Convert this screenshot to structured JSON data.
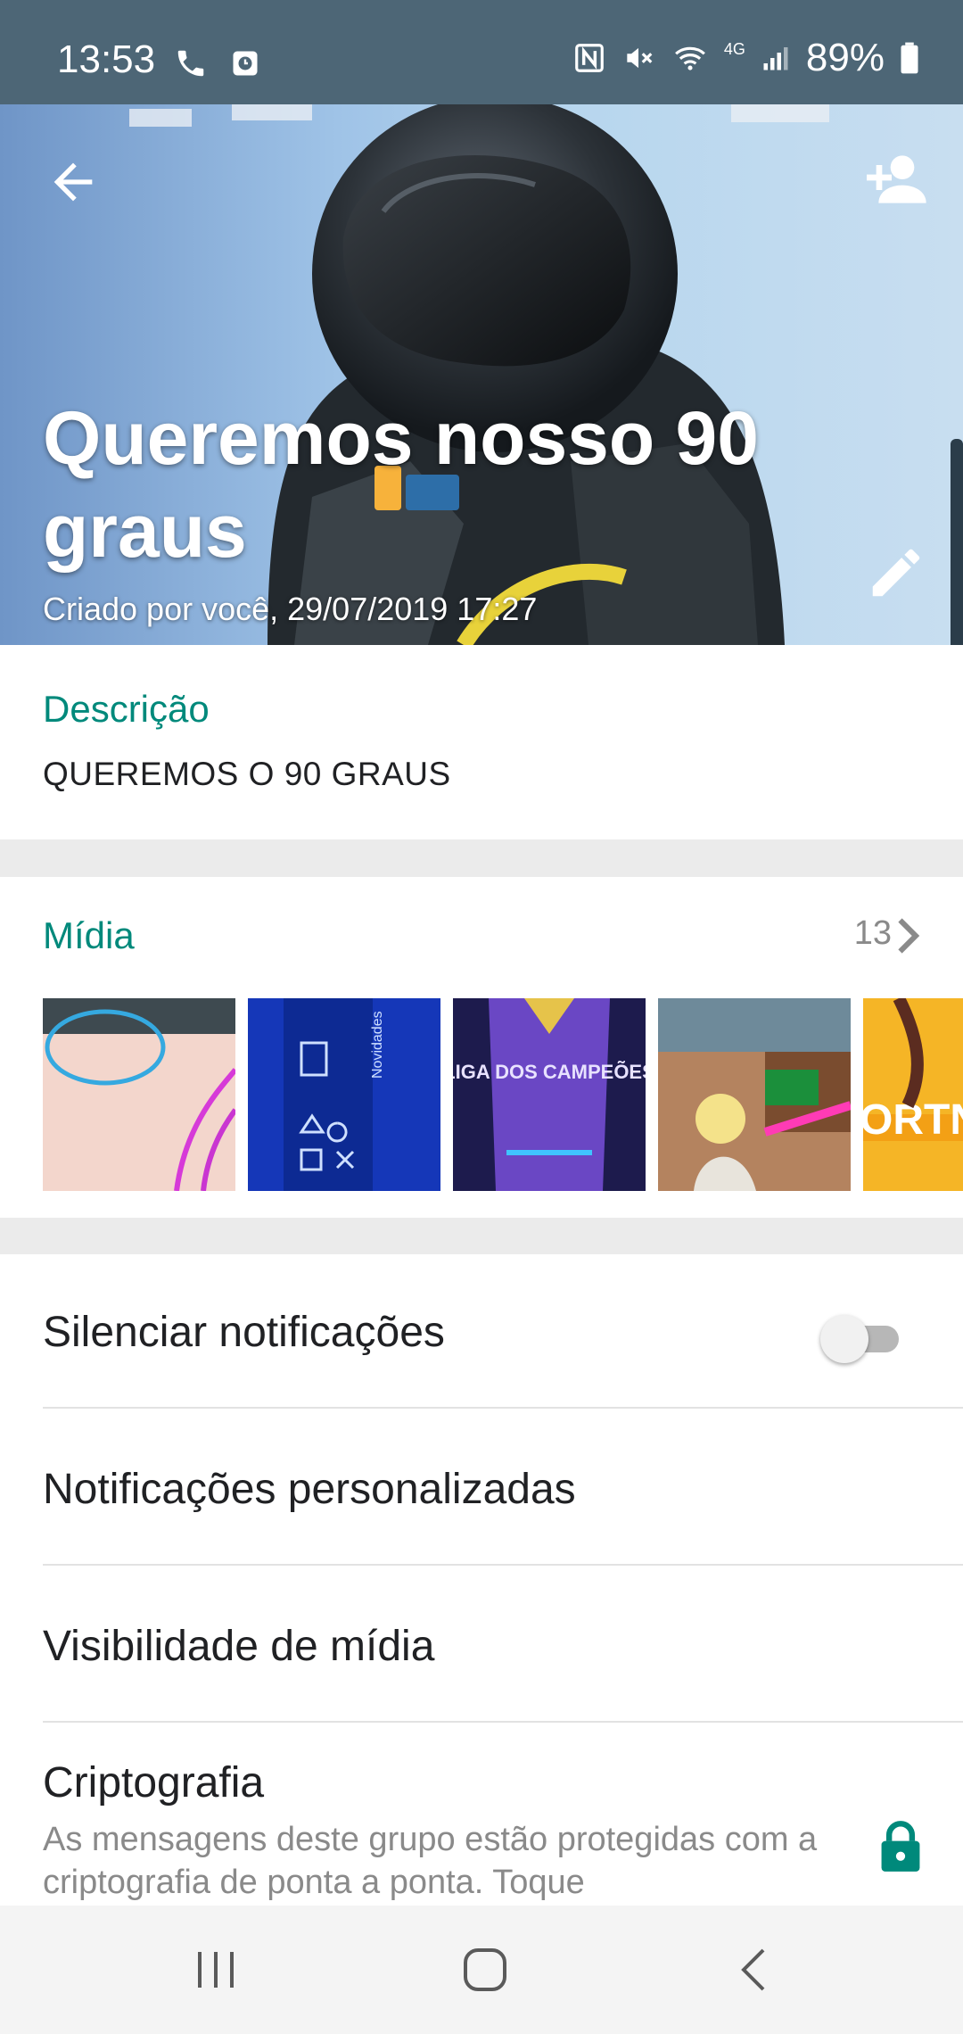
{
  "status_bar": {
    "time": "13:53",
    "network": "4G",
    "battery": "89%"
  },
  "header": {
    "title": "Queremos nosso 90 graus",
    "subtitle": "Criado por você, 29/07/2019 17:27"
  },
  "description": {
    "label": "Descrição",
    "text": "QUEREMOS O 90 GRAUS"
  },
  "media": {
    "label": "Mídia",
    "count": "13",
    "thumbnails": [
      {
        "id": "thumb-1",
        "text": ""
      },
      {
        "id": "thumb-2",
        "text": "Novidades"
      },
      {
        "id": "thumb-3",
        "text": "LIGA DOS CAMPEÕES"
      },
      {
        "id": "thumb-4",
        "text": ""
      },
      {
        "id": "thumb-5",
        "text": "ORTNIT"
      }
    ]
  },
  "settings": {
    "mute_label": "Silenciar notificações",
    "mute_enabled": false,
    "custom_notifications_label": "Notificações personalizadas",
    "media_visibility_label": "Visibilidade de mídia",
    "encryption_label": "Criptografia",
    "encryption_text": "As mensagens deste grupo estão protegidas com a criptografia de ponta a ponta. Toque"
  },
  "colors": {
    "accent": "#00897b",
    "status_bar": "#4d6676",
    "separator": "#ebebeb"
  },
  "icons": {
    "back": "arrow-left-icon",
    "add_member": "person-add-icon",
    "edit": "pencil-icon",
    "chevron": "chevron-right-icon",
    "lock": "lock-icon"
  }
}
